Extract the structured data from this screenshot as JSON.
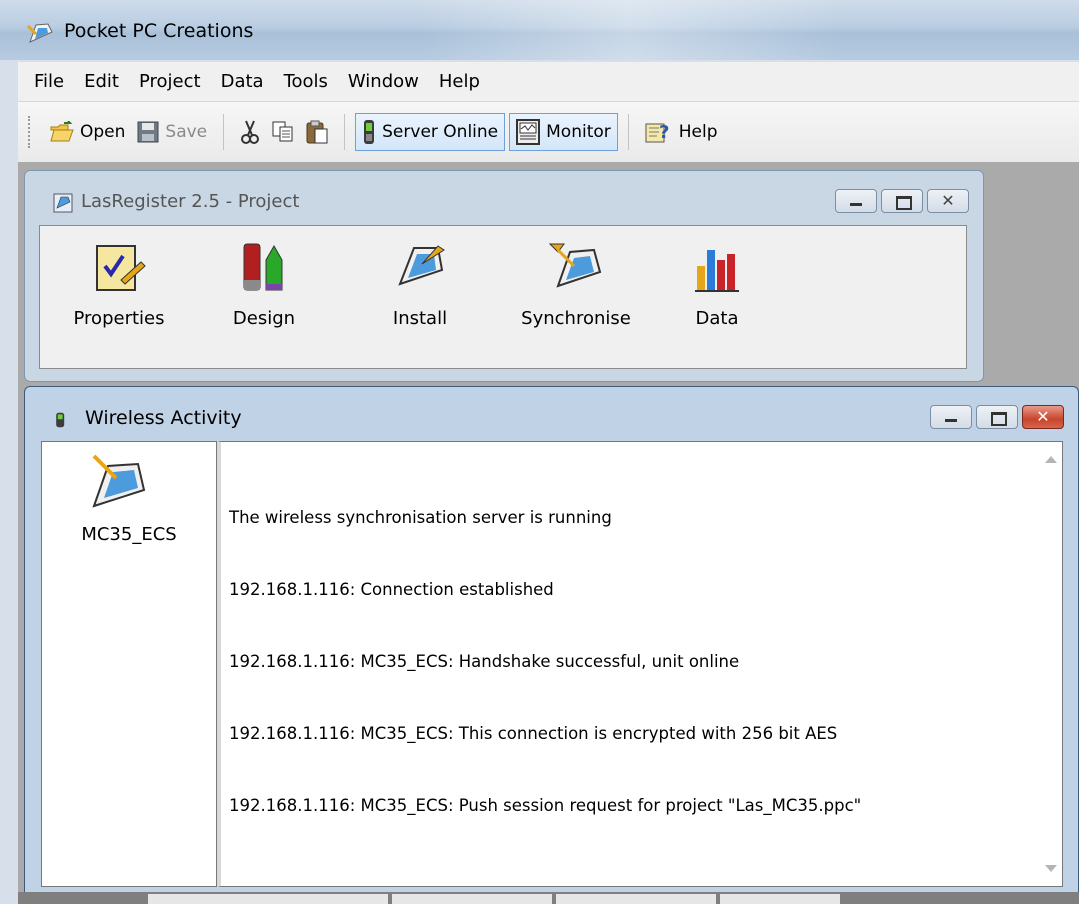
{
  "app": {
    "title": "Pocket PC Creations"
  },
  "menu": [
    "File",
    "Edit",
    "Project",
    "Data",
    "Tools",
    "Window",
    "Help"
  ],
  "toolbar": {
    "open": "Open",
    "save": "Save",
    "server_online": "Server Online",
    "monitor": "Monitor",
    "help": "Help"
  },
  "project_window": {
    "title": "LasRegister 2.5 - Project",
    "items": [
      "Properties",
      "Design",
      "Install",
      "Synchronise",
      "Data"
    ]
  },
  "wireless_window": {
    "title": "Wireless Activity",
    "device": "MC35_ECS",
    "log": [
      "The wireless synchronisation server is running",
      "192.168.1.116: Connection established",
      "192.168.1.116: MC35_ECS: Handshake successful, unit online",
      "192.168.1.116: MC35_ECS: This connection is encrypted with 256 bit AES",
      "192.168.1.116: MC35_ECS: Push session request for project \"Las_MC35.ppc\""
    ]
  },
  "colors": {
    "accent": "#3399ff",
    "close_red": "#c8442c"
  }
}
